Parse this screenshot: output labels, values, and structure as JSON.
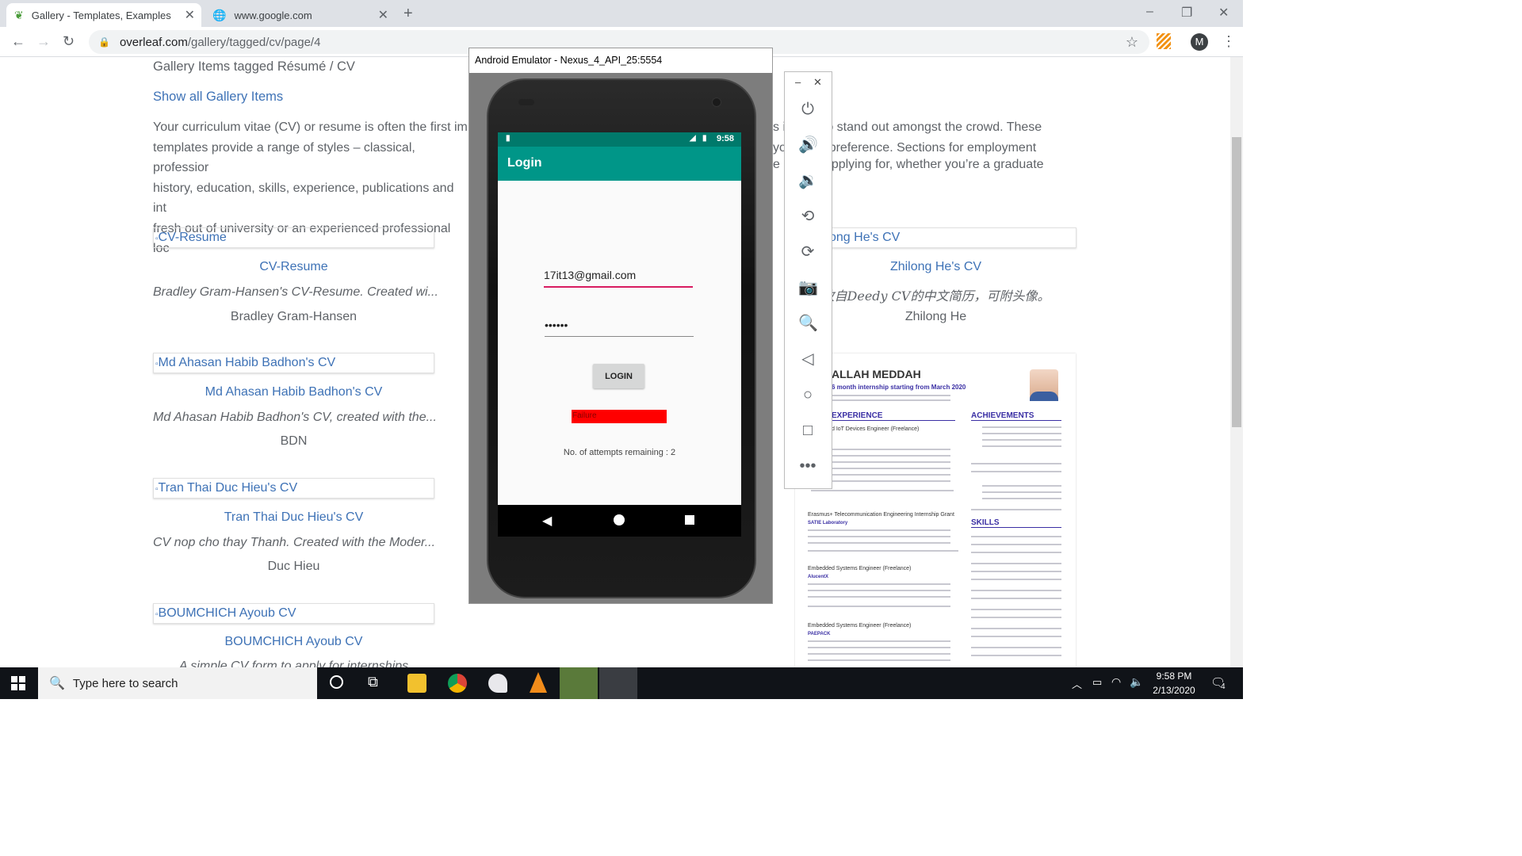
{
  "browser": {
    "tabs": [
      {
        "title": "Gallery - Templates, Examples an",
        "active": true
      },
      {
        "title": "www.google.com",
        "active": false
      }
    ],
    "new_tab": "+",
    "url_host": "overleaf.com",
    "url_path": "/gallery/tagged/cv/page/4",
    "profile_initial": "M",
    "window_controls": [
      "–",
      "❐",
      "✕"
    ]
  },
  "page": {
    "heading": "Gallery Items tagged Résumé / CV",
    "show_all": "Show all Gallery Items",
    "intro_left": [
      "Your curriculum vitae (CV) or resume is often the first im",
      "templates provide a range of styles – classical, professior",
      "history, education, skills, experience, publications and int",
      "fresh out of university or an experienced professional loc"
    ],
    "intro_right": [
      "s i",
      "t to stand out amongst the crowd. These",
      "yo",
      "nal preference. Sections for employment",
      "e re",
      "e applying for, whether you’re a graduate"
    ],
    "cards_left": [
      {
        "img_alt": "CV-Resume",
        "title": "CV-Resume",
        "desc": "Bradley Gram-Hansen's CV-Resume. Created wi...",
        "author": "Bradley Gram-Hansen"
      },
      {
        "img_alt": "Md Ahasan Habib Badhon's CV",
        "title": "Md Ahasan Habib Badhon's CV",
        "desc": "Md Ahasan Habib Badhon's CV, created with the...",
        "author": "BDN"
      },
      {
        "img_alt": "Tran Thai Duc Hieu's CV",
        "title": "Tran Thai Duc Hieu's CV",
        "desc": "CV nop cho thay Thanh. Created with the Moder...",
        "author": "Duc Hieu"
      },
      {
        "img_alt": "BOUMCHICH Ayoub CV",
        "title": "BOUMCHICH Ayoub CV",
        "desc": "A simple CV form to apply for internships",
        "author": ""
      }
    ],
    "card_right": {
      "img_alt": "ong He's CV",
      "title": "Zhilong He's CV",
      "desc": "改自Deedy CV的中文简历，可附头像。",
      "author": "Zhilong He"
    },
    "cv_preview": {
      "name": "ALLAH MEDDAH",
      "subtitle": "6 month internship starting from March 2020",
      "sections": [
        "EXPERIENCE",
        "ACHIEVEMENTS",
        "SKILLS"
      ],
      "jobs": [
        "d IoT Devices Engineer (Freelance)",
        "Erasmus+ Telecommunication Engineering Internship Grant",
        "Embedded Systems Engineer (Freelance)",
        "Embedded Systems Engineer (Freelance)"
      ],
      "companies": [
        "SATIE Laboratory",
        "AlucentX",
        "PAEPACK"
      ]
    }
  },
  "emulator": {
    "window_title": "Android Emulator - Nexus_4_API_25:5554",
    "status_time": "9:58",
    "app_title": "Login",
    "email_value": "17it13@gmail.com",
    "password_value": "••••••",
    "login_label": "LOGIN",
    "failure_text": "Failure",
    "attempts_text": "No. of attempts remaining : 2",
    "tools": [
      "power-icon",
      "volume-up-icon",
      "volume-down-icon",
      "rotate-left-icon",
      "rotate-right-icon",
      "camera-icon",
      "zoom-icon",
      "back-icon",
      "home-icon",
      "overview-icon",
      "more-icon"
    ]
  },
  "taskbar": {
    "search_placeholder": "Type here to search",
    "time": "9:58 PM",
    "date": "2/13/2020",
    "notification_count": "4"
  },
  "colors": {
    "link": "#3e72b6",
    "app_teal": "#009688",
    "failure_red": "#ff0000",
    "accent_pink": "#d81b60"
  }
}
